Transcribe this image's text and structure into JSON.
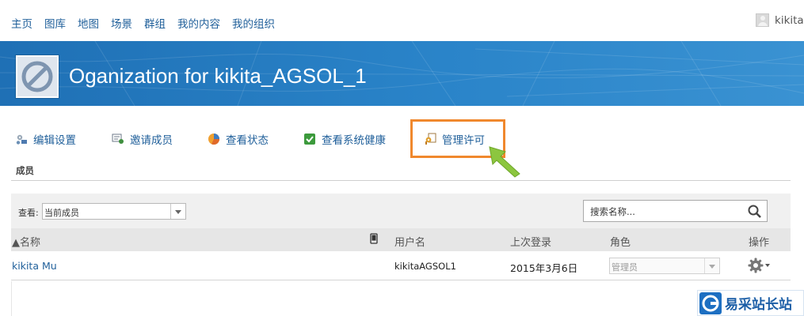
{
  "nav": {
    "links": [
      "主页",
      "图库",
      "地图",
      "场景",
      "群组",
      "我的内容",
      "我的组织"
    ],
    "username": "kikita"
  },
  "banner": {
    "title": "Oganization for kikita_AGSOL_1"
  },
  "toolbar": {
    "items": [
      {
        "label": "编辑设置",
        "icon": "edit-settings-icon"
      },
      {
        "label": "邀请成员",
        "icon": "invite-members-icon"
      },
      {
        "label": "查看状态",
        "icon": "pie-chart-icon"
      },
      {
        "label": "查看系统健康",
        "icon": "checkbox-checked-icon"
      },
      {
        "label": "管理许可",
        "icon": "license-key-icon"
      }
    ],
    "highlight_color": "#f0882d",
    "arrow_color": "#8cc63f"
  },
  "section": {
    "label": "成员"
  },
  "filter": {
    "view_label": "查看:",
    "view_value": "当前成员",
    "search_placeholder": "搜索名称..."
  },
  "table": {
    "headers": {
      "name": "▲名称",
      "username": "用户名",
      "last_login": "上次登录",
      "role": "角色",
      "actions": "操作"
    },
    "rows": [
      {
        "name": "kikita Mu",
        "username": "kikitaAGSOL1",
        "last_login": "2015年3月6日",
        "role": "管理员"
      }
    ]
  },
  "watermark": {
    "text": "易采站长站"
  },
  "colors": {
    "link": "#1f5f9a",
    "banner": "#2a84c9",
    "highlight": "#f0882d"
  }
}
